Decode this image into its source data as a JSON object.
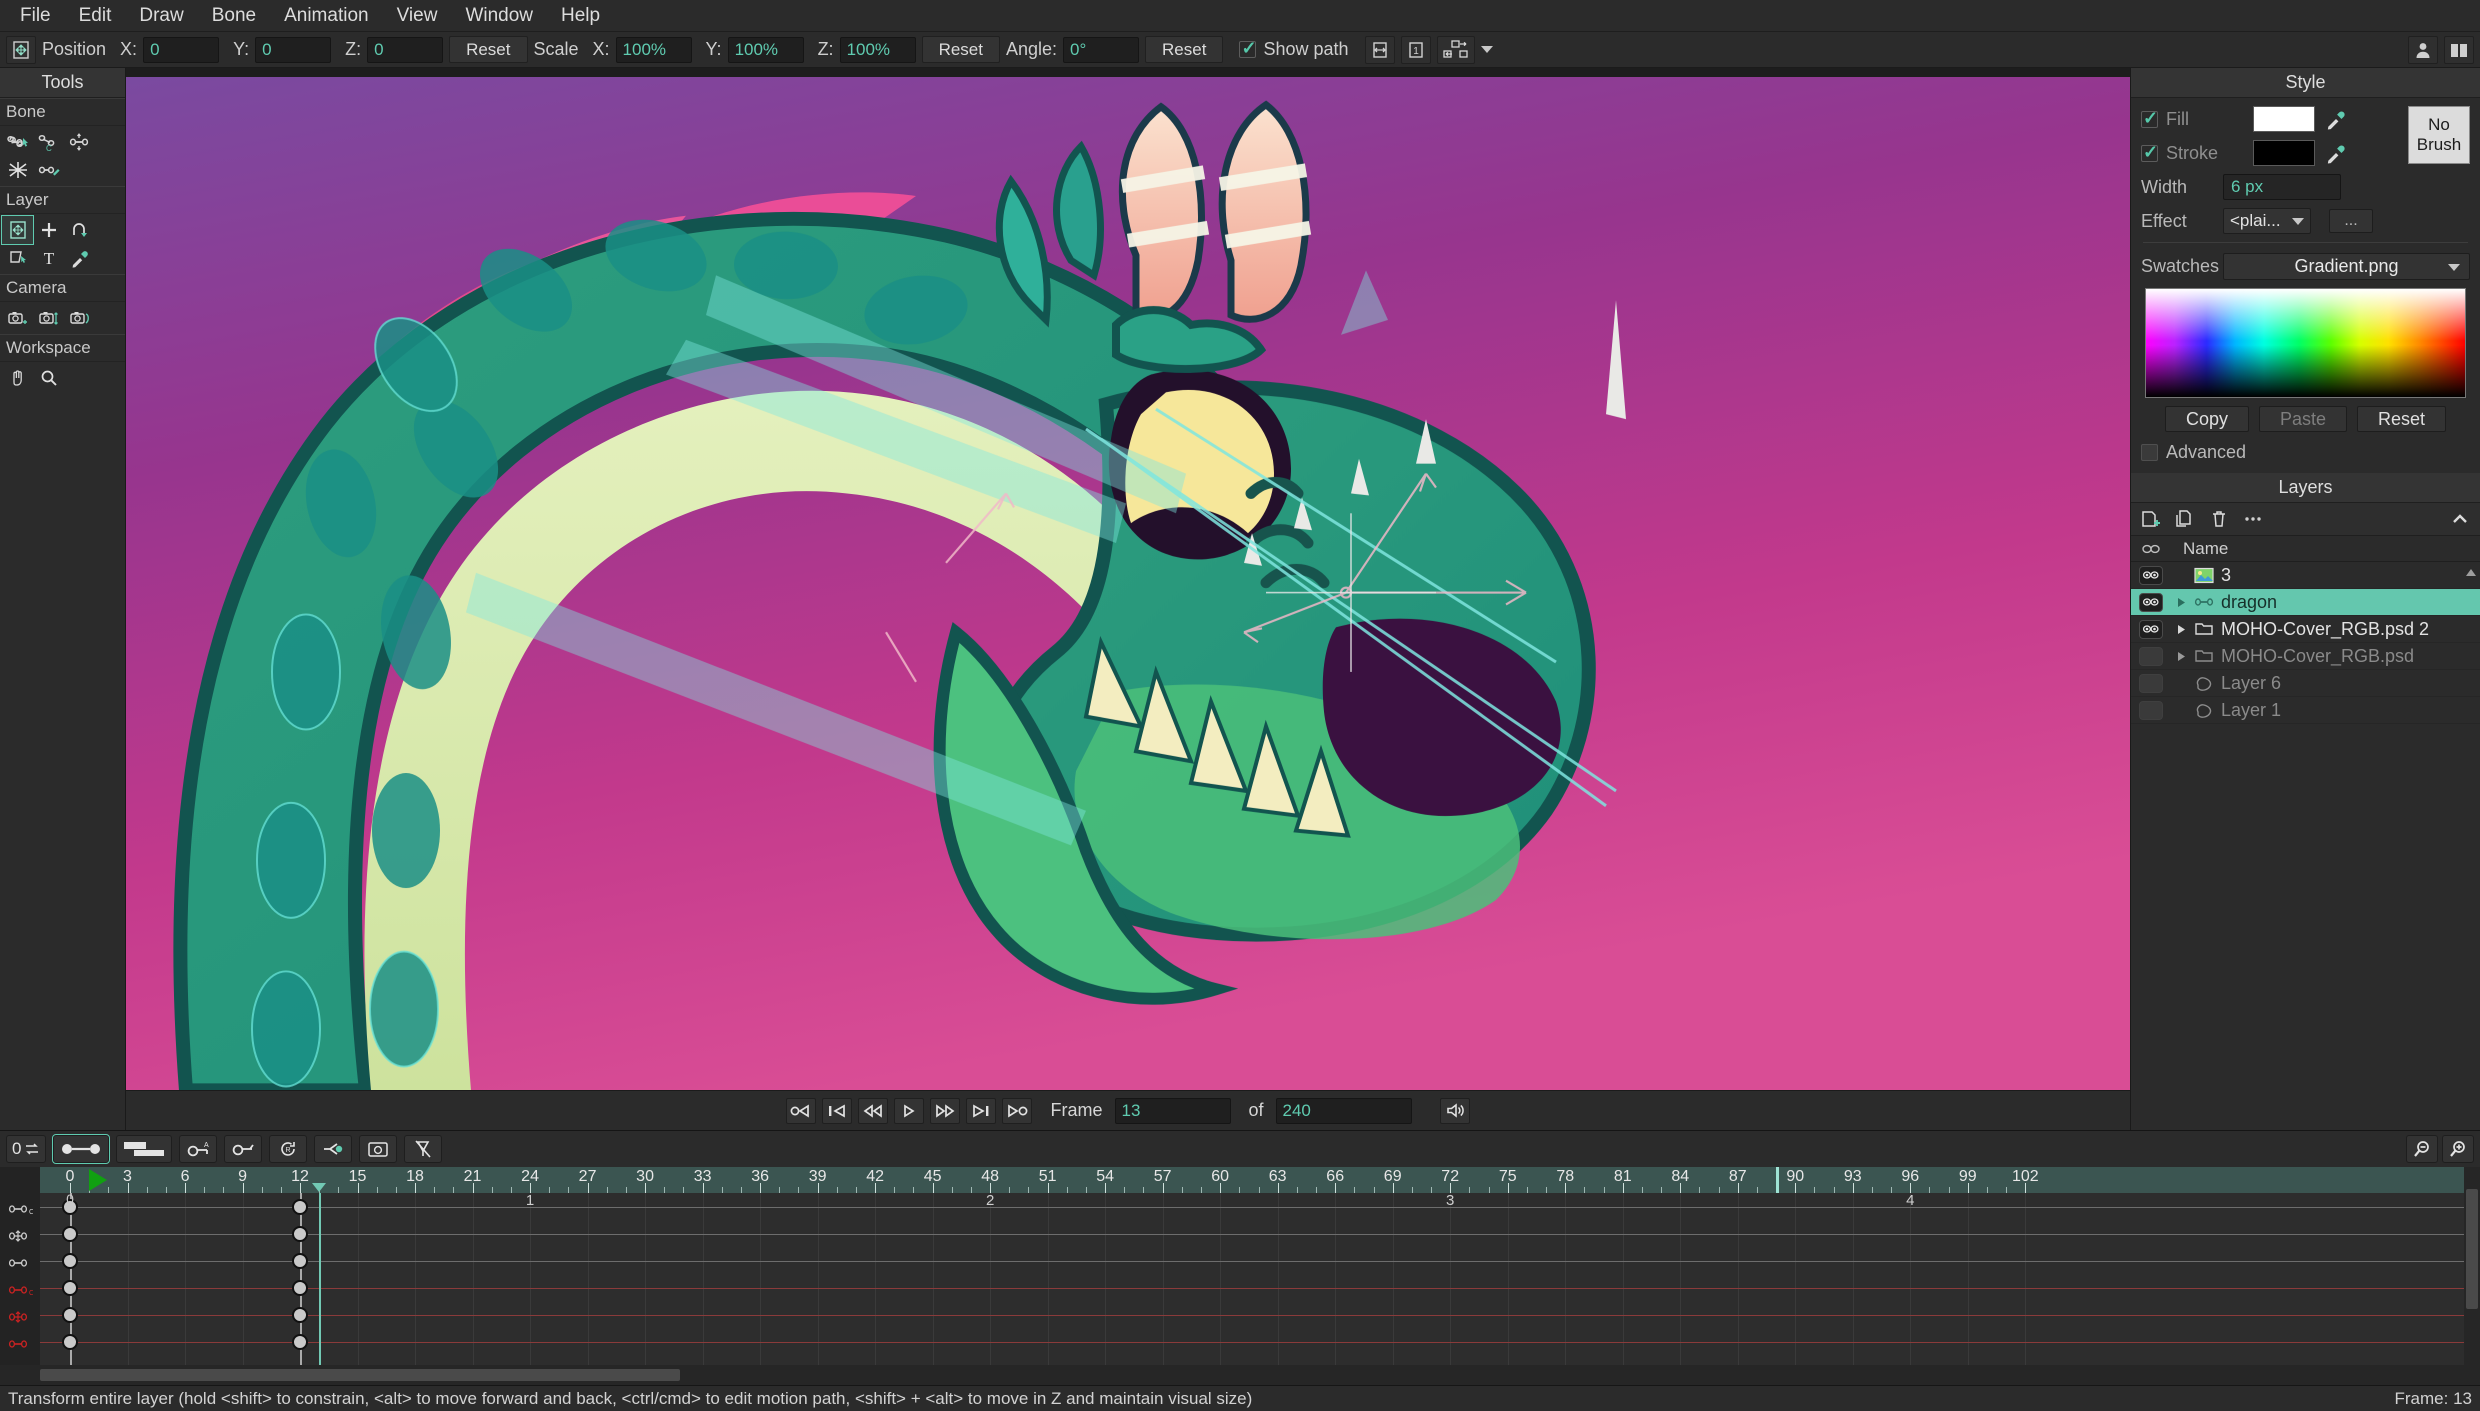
{
  "menu": {
    "items": [
      "File",
      "Edit",
      "Draw",
      "Bone",
      "Animation",
      "View",
      "Window",
      "Help"
    ]
  },
  "toolbar": {
    "position_label": "Position",
    "x_label": "X:",
    "y_label": "Y:",
    "z_label": "Z:",
    "position_x": "0",
    "position_y": "0",
    "position_z": "0",
    "reset_position": "Reset",
    "scale_label": "Scale",
    "scale_x": "100%",
    "scale_y": "100%",
    "scale_z": "100%",
    "reset_scale": "Reset",
    "angle_label": "Angle:",
    "angle_value": "0°",
    "reset_angle": "Reset",
    "show_path_label": "Show path"
  },
  "tools": {
    "title": "Tools",
    "groups": [
      {
        "name": "Bone",
        "tools": [
          "bone-transform-icon",
          "bone-manipulate-icon",
          "bone-offset-icon",
          "bone-flexi-bind-icon",
          "bone-bind-points-icon"
        ]
      },
      {
        "name": "Layer",
        "tools": [
          "transform-layer-icon",
          "add-point-icon",
          "rotate-layer-xy-icon",
          "shear-layer-icon",
          "text-icon",
          "eyedropper-icon"
        ]
      },
      {
        "name": "Camera",
        "tools": [
          "track-camera-icon",
          "zoom-camera-icon",
          "roll-camera-icon"
        ]
      },
      {
        "name": "Workspace",
        "tools": [
          "pan-icon",
          "zoom-icon"
        ]
      }
    ]
  },
  "style": {
    "title": "Style",
    "fill_label": "Fill",
    "fill_color": "#ffffff",
    "stroke_label": "Stroke",
    "stroke_color": "#000000",
    "no_brush_label": "No Brush",
    "width_label": "Width",
    "width_value": "6 px",
    "effect_label": "Effect",
    "effect_value": "<plai...",
    "more_label": "...",
    "swatches_label": "Swatches",
    "swatches_value": "Gradient.png",
    "copy_label": "Copy",
    "paste_label": "Paste",
    "reset_label": "Reset",
    "advanced_label": "Advanced"
  },
  "layers": {
    "title": "Layers",
    "column_name": "Name",
    "rows": [
      {
        "name": "3",
        "visible": true,
        "type": "image",
        "expandable": false,
        "selected": false
      },
      {
        "name": "dragon",
        "visible": true,
        "type": "bone",
        "expandable": true,
        "selected": true
      },
      {
        "name": "MOHO-Cover_RGB.psd 2",
        "visible": true,
        "type": "group",
        "expandable": true,
        "selected": false
      },
      {
        "name": "MOHO-Cover_RGB.psd",
        "visible": false,
        "type": "group",
        "expandable": true,
        "selected": false
      },
      {
        "name": "Layer 6",
        "visible": false,
        "type": "vector",
        "expandable": false,
        "selected": false
      },
      {
        "name": "Layer 1",
        "visible": false,
        "type": "vector",
        "expandable": false,
        "selected": false
      }
    ]
  },
  "playback": {
    "buttons": [
      "rewind-to-start-icon",
      "previous-keyframe-icon",
      "step-back-icon",
      "play-icon",
      "step-forward-icon",
      "next-keyframe-icon",
      "jump-to-end-icon"
    ],
    "frame_label": "Frame",
    "frame_value": "13",
    "of_label": "of",
    "total_frames": "240",
    "audio_icon": "speaker-icon"
  },
  "timeline": {
    "mode_label": "0",
    "tools": [
      "frame-zero-toggle",
      "smooth-interpolation-icon",
      "step-interpolation-icon",
      "add-keyframe-icon",
      "key-icon",
      "cycle-icon",
      "noise-icon",
      "camera-key-icon",
      "disable-key-icon"
    ],
    "ruler_start": 0,
    "ruler_end": 102,
    "ruler_step": 3,
    "ruler_labels": [
      0,
      3,
      6,
      9,
      12,
      15,
      18,
      21,
      24,
      27,
      30,
      33,
      36,
      39,
      42,
      45,
      48,
      51,
      54,
      57,
      60,
      63,
      66,
      69,
      72,
      75,
      78,
      81,
      84,
      87,
      90,
      93,
      96,
      99,
      102
    ],
    "second_markers": [
      {
        "label": "1",
        "frame": 24
      },
      {
        "label": "2",
        "frame": 48
      },
      {
        "label": "3",
        "frame": 72
      },
      {
        "label": "4",
        "frame": 96
      }
    ],
    "playhead_frame": 13,
    "current_marker_frame": 89,
    "green_cursor_frame": 1,
    "channel_icons": [
      "bone-rotate-icon",
      "bone-translate-icon",
      "bone-scale-icon",
      "bone-rotate-red-icon",
      "bone-translate-red-icon",
      "bone-scale-red-icon"
    ],
    "keyframe_columns": [
      0,
      12
    ],
    "track_count": 6,
    "red_tracks": [
      3,
      4,
      5
    ]
  },
  "statusbar": {
    "message": "Transform entire layer (hold <shift> to constrain, <alt> to move forward and back, <ctrl/cmd> to edit motion path, <shift> + <alt> to move in Z and maintain visual size)",
    "frame_label": "Frame: 13"
  },
  "colors": {
    "accent": "#5fcbb0",
    "selection": "#64c7ae",
    "panel_bg": "#2b2b2b",
    "canvas_bg": "#9a3f86",
    "ruler_bg": "#3b5551"
  }
}
